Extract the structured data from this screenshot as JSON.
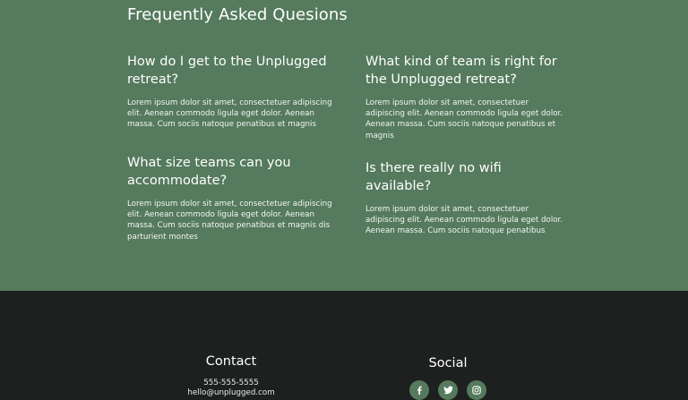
{
  "faq": {
    "title": "Frequently Asked Quesions",
    "items": [
      {
        "question": "How do I get to the Unplugged retreat?",
        "answer": "Lorem ipsum dolor sit amet, consectetuer adipiscing elit. Aenean commodo ligula eget dolor. Aenean massa. Cum sociis natoque penatibus et magnis"
      },
      {
        "question": "What kind of team is right for the Unplugged retreat?",
        "answer": "Lorem ipsum dolor sit amet, consectetuer adipiscing elit. Aenean commodo ligula eget dolor. Aenean massa. Cum sociis natoque penatibus et magnis"
      },
      {
        "question": "What size teams can you accommodate?",
        "answer": "Lorem ipsum dolor sit amet, consectetuer adipiscing elit. Aenean commodo ligula eget dolor. Aenean massa. Cum sociis natoque penatibus et magnis dis parturient montes"
      },
      {
        "question": "Is there really no wifi available?",
        "answer": "Lorem ipsum dolor sit amet, consectetuer adipiscing elit. Aenean commodo ligula eget dolor. Aenean massa. Cum sociis natoque penatibus"
      }
    ]
  },
  "footer": {
    "contact": {
      "heading": "Contact",
      "phone": "555-555-5555",
      "email": "hello@unplugged.com"
    },
    "social": {
      "heading": "Social",
      "icons": [
        "facebook-icon",
        "twitter-icon",
        "instagram-icon"
      ]
    }
  },
  "colors": {
    "section_green": "#557a5d",
    "footer_dark": "#1e2020",
    "text": "#ffffff"
  }
}
